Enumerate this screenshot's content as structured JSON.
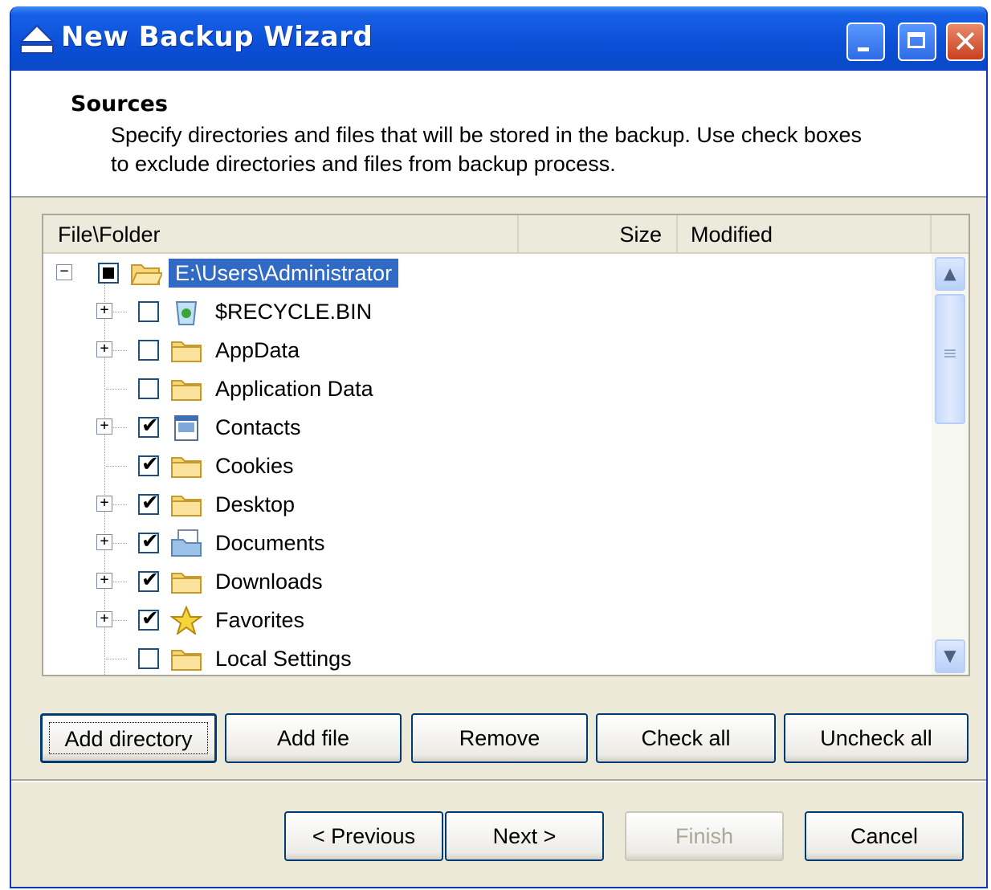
{
  "window": {
    "title": "New Backup Wizard",
    "close_glyph": "✕"
  },
  "header": {
    "title": "Sources",
    "description": "Specify directories and files that will be stored in the backup. Use check boxes to exclude directories and files from backup process."
  },
  "columns": {
    "file": "File\\Folder",
    "size": "Size",
    "modified": "Modified"
  },
  "tree": {
    "root": {
      "label": "E:\\Users\\Administrator",
      "check": "partial",
      "expander": "−"
    },
    "children": [
      {
        "label": "$RECYCLE.BIN",
        "checked": false,
        "expandable": true,
        "icon": "recycle-bin-icon"
      },
      {
        "label": "AppData",
        "checked": false,
        "expandable": true,
        "icon": "folder-icon"
      },
      {
        "label": "Application Data",
        "checked": false,
        "expandable": false,
        "icon": "folder-icon"
      },
      {
        "label": "Contacts",
        "checked": true,
        "expandable": true,
        "icon": "contacts-icon"
      },
      {
        "label": "Cookies",
        "checked": true,
        "expandable": false,
        "icon": "folder-icon"
      },
      {
        "label": "Desktop",
        "checked": true,
        "expandable": true,
        "icon": "folder-icon"
      },
      {
        "label": "Documents",
        "checked": true,
        "expandable": true,
        "icon": "documents-icon"
      },
      {
        "label": "Downloads",
        "checked": true,
        "expandable": true,
        "icon": "folder-icon"
      },
      {
        "label": "Favorites",
        "checked": true,
        "expandable": true,
        "icon": "favorites-star-icon"
      },
      {
        "label": "Local Settings",
        "checked": false,
        "expandable": false,
        "icon": "folder-icon"
      }
    ],
    "plus_glyph": "+",
    "check_glyph": "✔"
  },
  "scrollbar": {
    "up_glyph": "▲",
    "down_glyph": "▼",
    "grip_glyph": "≡"
  },
  "actions": {
    "add_directory": "Add directory",
    "add_file": "Add file",
    "remove": "Remove",
    "check_all": "Check all",
    "uncheck_all": "Uncheck all"
  },
  "nav": {
    "previous": "< Previous",
    "next": "Next >",
    "finish": "Finish",
    "cancel": "Cancel"
  },
  "colors": {
    "titlebar": "#0A48C6",
    "selection": "#316AC5",
    "dialog_bg": "#ECE9D8"
  }
}
